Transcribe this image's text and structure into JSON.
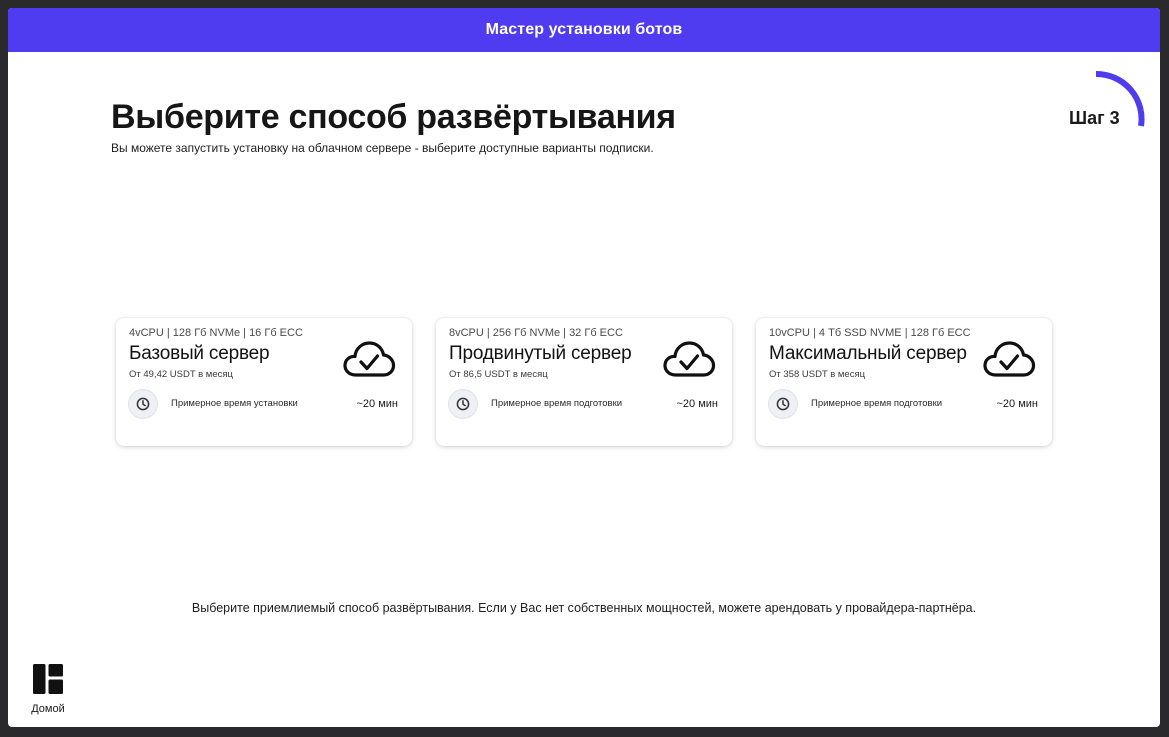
{
  "window": {
    "title": "Мастер установки ботов"
  },
  "header": {
    "title": "Выберите способ развёртывания",
    "subtitle": "Вы можете запустить установку на облачном сервере - выберите доступные варианты подписки."
  },
  "step": {
    "label": "Шаг 3",
    "accent": "#4f3bf0"
  },
  "cards": [
    {
      "specs": "4vCPU | 128 Гб NVMe | 16 Гб ECC",
      "title": "Базовый сервер",
      "price": "От 49,42 USDT в месяц",
      "time_label": "Примерное время установки",
      "time_value": "~20 мин",
      "icon": "cloud-check-icon"
    },
    {
      "specs": "8vCPU | 256 Гб NVMe | 32 Гб ECC",
      "title": "Продвинутый сервер",
      "price": "От 86,5 USDT в месяц",
      "time_label": "Примерное время подготовки",
      "time_value": "~20 мин",
      "icon": "cloud-check-icon"
    },
    {
      "specs": "10vCPU | 4 Тб SSD NVME | 128 Гб ECC",
      "title": "Максимальный сервер",
      "price": "От 358 USDT в месяц",
      "time_label": "Примерное время подготовки",
      "time_value": "~20 мин",
      "icon": "cloud-check-icon"
    }
  ],
  "footer": {
    "hint": "Выберите приемлиемый способ развёртывания. Если у Вас нет собственных мощностей, можете арендовать у провайдера-партнёра."
  },
  "nav": {
    "home_label": "Домой",
    "home_icon": "dashboard-icon"
  },
  "colors": {
    "accent": "#4f3bf0",
    "background": "#ffffff",
    "frame": "#2a2a2c"
  }
}
